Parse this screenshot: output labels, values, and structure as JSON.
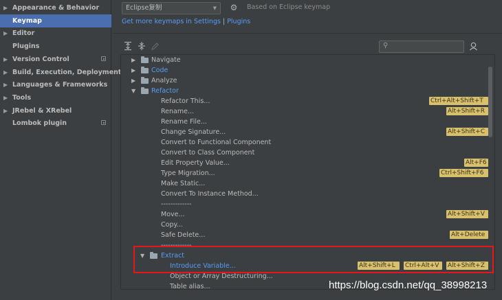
{
  "sidebar": {
    "items": [
      {
        "label": "Appearance & Behavior",
        "expandable": true,
        "selected": false,
        "badge": false
      },
      {
        "label": "Keymap",
        "expandable": false,
        "selected": true,
        "badge": false
      },
      {
        "label": "Editor",
        "expandable": true,
        "selected": false,
        "badge": false
      },
      {
        "label": "Plugins",
        "expandable": false,
        "selected": false,
        "badge": false
      },
      {
        "label": "Version Control",
        "expandable": true,
        "selected": false,
        "badge": true
      },
      {
        "label": "Build, Execution, Deployment",
        "expandable": true,
        "selected": false,
        "badge": false
      },
      {
        "label": "Languages & Frameworks",
        "expandable": true,
        "selected": false,
        "badge": false
      },
      {
        "label": "Tools",
        "expandable": true,
        "selected": false,
        "badge": false
      },
      {
        "label": "JRebel & XRebel",
        "expandable": true,
        "selected": false,
        "badge": false
      },
      {
        "label": "Lombok plugin",
        "expandable": false,
        "selected": false,
        "badge": true
      }
    ]
  },
  "keymap": {
    "selected": "Eclipse复制",
    "based_on": "Based on Eclipse keymap",
    "more_prefix": "Get more keymaps in Settings",
    "separator": " | ",
    "plugins_link": "Plugins"
  },
  "search": {
    "value": "",
    "placeholder": ""
  },
  "tree": {
    "rows": [
      {
        "level": 0,
        "type": "folder",
        "state": "collapsed",
        "label": "Navigate",
        "blue": false,
        "shortcuts": []
      },
      {
        "level": 0,
        "type": "folder",
        "state": "collapsed",
        "label": "Code",
        "blue": true,
        "shortcuts": []
      },
      {
        "level": 0,
        "type": "folder",
        "state": "collapsed",
        "label": "Analyze",
        "blue": false,
        "shortcuts": []
      },
      {
        "level": 0,
        "type": "folder",
        "state": "expanded",
        "label": "Refactor",
        "blue": true,
        "shortcuts": []
      },
      {
        "level": 1,
        "type": "action",
        "label": "Refactor This...",
        "blue": false,
        "shortcuts": [
          "Ctrl+Alt+Shift+T"
        ]
      },
      {
        "level": 1,
        "type": "action",
        "label": "Rename...",
        "blue": false,
        "shortcuts": [
          "Alt+Shift+R"
        ]
      },
      {
        "level": 1,
        "type": "action",
        "label": "Rename File...",
        "blue": false,
        "shortcuts": []
      },
      {
        "level": 1,
        "type": "action",
        "label": "Change Signature...",
        "blue": false,
        "shortcuts": [
          "Alt+Shift+C"
        ]
      },
      {
        "level": 1,
        "type": "action",
        "label": "Convert to Functional Component",
        "blue": false,
        "shortcuts": []
      },
      {
        "level": 1,
        "type": "action",
        "label": "Convert to Class Component",
        "blue": false,
        "shortcuts": []
      },
      {
        "level": 1,
        "type": "action",
        "label": "Edit Property Value...",
        "blue": false,
        "shortcuts": [
          "Alt+F6"
        ]
      },
      {
        "level": 1,
        "type": "action",
        "label": "Type Migration...",
        "blue": false,
        "shortcuts": [
          "Ctrl+Shift+F6"
        ]
      },
      {
        "level": 1,
        "type": "action",
        "label": "Make Static...",
        "blue": false,
        "shortcuts": []
      },
      {
        "level": 1,
        "type": "action",
        "label": "Convert To Instance Method...",
        "blue": false,
        "shortcuts": []
      },
      {
        "level": 1,
        "type": "separator",
        "label": "-------------",
        "blue": false,
        "shortcuts": []
      },
      {
        "level": 1,
        "type": "action",
        "label": "Move...",
        "blue": false,
        "shortcuts": [
          "Alt+Shift+V"
        ]
      },
      {
        "level": 1,
        "type": "action",
        "label": "Copy...",
        "blue": false,
        "shortcuts": []
      },
      {
        "level": 1,
        "type": "action",
        "label": "Safe Delete...",
        "blue": false,
        "shortcuts": [
          "Alt+Delete"
        ]
      },
      {
        "level": 1,
        "type": "separator",
        "label": "-------------",
        "blue": false,
        "shortcuts": []
      },
      {
        "level": 1,
        "type": "folder",
        "state": "expanded",
        "label": "Extract",
        "blue": true,
        "shortcuts": []
      },
      {
        "level": 2,
        "type": "action",
        "label": "Introduce Variable...",
        "blue": true,
        "shortcuts": [
          "Alt+Shift+L",
          "Ctrl+Alt+V",
          "Alt+Shift+Z"
        ]
      },
      {
        "level": 2,
        "type": "action",
        "label": "Object or Array Destructuring...",
        "blue": false,
        "shortcuts": []
      },
      {
        "level": 2,
        "type": "action",
        "label": "Table alias...",
        "blue": false,
        "shortcuts": []
      }
    ]
  },
  "watermark": "https://blog.csdn.net/qq_38998213"
}
